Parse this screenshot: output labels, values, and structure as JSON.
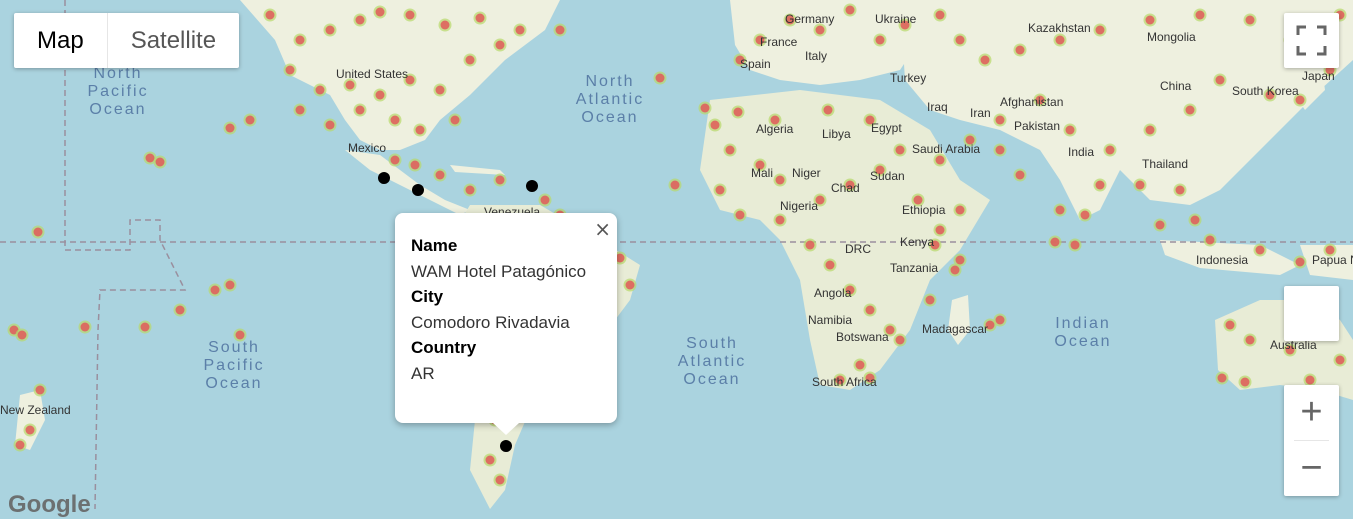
{
  "map_type": {
    "map_label": "Map",
    "satellite_label": "Satellite",
    "selected": "Map"
  },
  "popup": {
    "name_label": "Name",
    "name_value": "WAM Hotel Patagónico",
    "city_label": "City",
    "city_value": "Comodoro Rivadavia",
    "country_label": "Country",
    "country_value": "AR",
    "close_symbol": "×"
  },
  "controls": {
    "zoom_in": "+",
    "zoom_out": "−"
  },
  "attribution": "Google",
  "countries": [
    "United States",
    "Mexico",
    "Venezuela",
    "Germany",
    "Ukraine",
    "France",
    "Italy",
    "Spain",
    "Turkey",
    "Kazakhstan",
    "Mongolia",
    "China",
    "Japan",
    "South Korea",
    "Afghanistan",
    "Pakistan",
    "Iraq",
    "Iran",
    "India",
    "Thailand",
    "Algeria",
    "Libya",
    "Egypt",
    "Saudi Arabia",
    "Mali",
    "Niger",
    "Chad",
    "Sudan",
    "Nigeria",
    "Ethiopia",
    "Kenya",
    "DRC",
    "Tanzania",
    "Angola",
    "Namibia",
    "Botswana",
    "Madagascar",
    "South Africa",
    "Indonesia",
    "Papua New Guinea",
    "Australia",
    "New Zealand"
  ],
  "oceans": {
    "north_pacific": [
      "North",
      "Pacific",
      "Ocean"
    ],
    "north_atlantic": [
      "North",
      "Atlantic",
      "Ocean"
    ],
    "south_pacific": [
      "South",
      "Pacific",
      "Ocean"
    ],
    "south_atlantic": [
      "South",
      "Atlantic",
      "Ocean"
    ],
    "indian": [
      "Indian",
      "Ocean"
    ]
  },
  "markers": [
    {
      "name": "marker-mexico-west"
    },
    {
      "name": "marker-mexico-south"
    },
    {
      "name": "marker-caribbean"
    },
    {
      "name": "marker-comodoro-rivadavia"
    }
  ],
  "colors": {
    "water": "#aad3df",
    "land": "#f2efe9",
    "park": "#c8e6b4",
    "heat": "#e05a5a",
    "heat_halo": "#b8d96a",
    "marker": "#000000"
  }
}
